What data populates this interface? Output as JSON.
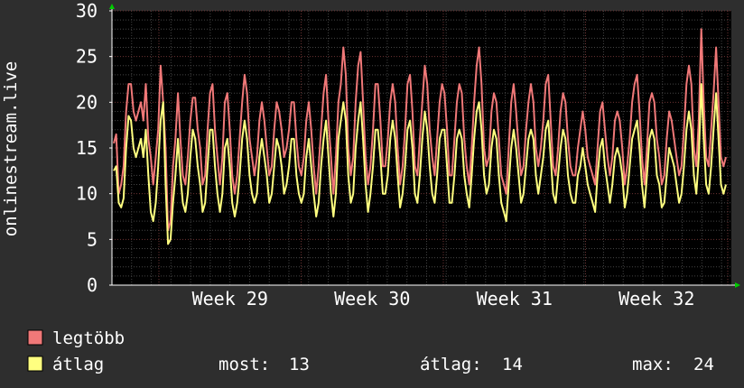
{
  "chart_data": {
    "type": "line",
    "ylabel": "onlinestream.live",
    "ylim": [
      0,
      30
    ],
    "yticks": [
      0,
      5,
      10,
      15,
      20,
      25,
      30
    ],
    "x_tick_labels": [
      "Week 29",
      "Week 30",
      "Week 31",
      "Week 32"
    ],
    "grid": true,
    "legend_placement": "bottom-left",
    "colors": {
      "background": "#2e2e2e",
      "plot_background": "#000000",
      "grid_major": "#6b3333",
      "grid_minor": "#444444",
      "axis": "#ffffff",
      "arrow": "#00cc00"
    },
    "series": [
      {
        "name": "legtöbb",
        "color": "#f07878",
        "values": [
          15.5,
          16.5,
          10,
          11,
          13,
          19,
          22,
          22,
          19,
          18,
          19,
          20,
          18,
          22,
          16,
          14,
          11,
          14,
          17,
          24,
          20,
          15,
          6,
          7,
          13,
          16,
          21,
          16,
          12,
          11,
          14,
          18,
          20.5,
          20.5,
          17,
          15,
          11,
          12,
          17,
          21,
          22,
          17,
          14,
          11,
          14,
          20,
          21,
          17,
          12,
          10,
          12,
          16,
          20,
          23,
          21,
          16,
          14,
          12,
          14,
          18,
          20,
          18,
          15,
          12,
          13,
          17,
          20,
          19,
          17,
          14,
          15,
          17,
          20,
          20,
          16,
          13,
          12,
          14,
          18,
          20,
          17,
          13,
          10,
          13,
          17,
          21,
          23,
          18,
          14,
          10,
          14,
          20,
          22,
          26,
          23,
          15,
          12,
          14,
          20,
          24,
          25.5,
          20,
          14,
          11,
          13,
          17,
          22,
          22,
          18,
          13,
          13,
          16,
          20,
          22,
          20,
          15,
          11,
          13,
          17,
          22,
          23,
          19,
          13,
          12,
          16,
          20,
          24,
          22,
          17,
          14,
          12,
          16,
          20,
          22,
          21,
          17,
          12,
          12,
          16,
          20,
          22,
          21,
          16,
          13,
          11,
          15,
          20,
          24,
          26,
          22,
          15,
          13,
          14,
          19,
          21,
          20,
          16,
          12,
          11,
          10,
          15,
          20,
          22,
          19,
          15,
          12,
          13,
          17,
          20,
          22,
          20,
          15,
          13,
          15,
          18,
          22,
          23,
          18,
          13,
          12,
          15,
          19,
          21,
          20,
          16,
          13,
          12,
          12,
          15,
          17,
          19,
          17,
          14,
          13,
          12,
          11,
          15,
          19,
          20,
          17,
          14,
          12,
          14,
          18,
          19,
          18,
          15,
          11,
          13,
          16,
          20,
          22,
          23,
          19,
          14,
          11,
          15,
          20,
          21,
          20,
          16,
          14,
          11,
          12,
          16,
          19,
          18,
          16,
          14,
          12,
          13,
          17,
          22,
          24,
          22,
          15,
          13,
          18,
          28,
          20,
          14,
          13,
          17,
          21,
          26,
          20,
          14,
          13,
          14
        ]
      },
      {
        "name": "átlag",
        "color": "#ffff80",
        "values": [
          12.5,
          13,
          9,
          8.5,
          9.5,
          15,
          18.5,
          18,
          15,
          14,
          15,
          16,
          14,
          17,
          12,
          8,
          7,
          9,
          13,
          18,
          20,
          11,
          4.5,
          5,
          9,
          12,
          16,
          12,
          9,
          8,
          10,
          14,
          17,
          16,
          13,
          11,
          8,
          9,
          13,
          17,
          17,
          13,
          10,
          8,
          10,
          15,
          16,
          13,
          9,
          7.5,
          9,
          12,
          16,
          18,
          16,
          12,
          10,
          9,
          10,
          14,
          16,
          14,
          12,
          9,
          10,
          13,
          16,
          15,
          13,
          10,
          11,
          13,
          16,
          16,
          12,
          10,
          9,
          10,
          14,
          16,
          13,
          10,
          7.5,
          9,
          13,
          16,
          18,
          14,
          10,
          7.5,
          10,
          16,
          18,
          20,
          18,
          12,
          9,
          10,
          15,
          18,
          20,
          16,
          11,
          8,
          10,
          13,
          17,
          17,
          14,
          10,
          10,
          12,
          16,
          18,
          16,
          12,
          8.5,
          10,
          13,
          17,
          18,
          15,
          10,
          9,
          12,
          16,
          19,
          17,
          13,
          10,
          9,
          12,
          16,
          17,
          17,
          13,
          9,
          9,
          12,
          16,
          17,
          16,
          12,
          10,
          8.5,
          12,
          16,
          19,
          20,
          17,
          12,
          10,
          11,
          15,
          17,
          16,
          12,
          9,
          8,
          7,
          11,
          15,
          17,
          15,
          12,
          9,
          10,
          13,
          16,
          17,
          16,
          12,
          10,
          12,
          14,
          17,
          18,
          14,
          10,
          9,
          12,
          15,
          17,
          16,
          12,
          10,
          9,
          9,
          12,
          13,
          15,
          13,
          11,
          10,
          9,
          8,
          12,
          15,
          16,
          13,
          11,
          9,
          11,
          14,
          15,
          14,
          12,
          8.5,
          10,
          13,
          16,
          17,
          18,
          15,
          11,
          8.5,
          12,
          16,
          17,
          16,
          12,
          11,
          8.5,
          9,
          12,
          15,
          14,
          13,
          11,
          9,
          10,
          13,
          17,
          19,
          17,
          12,
          10,
          14,
          22,
          16,
          11,
          10,
          13,
          17,
          21,
          16,
          11,
          10,
          11
        ]
      }
    ]
  },
  "legend": {
    "items": [
      {
        "label": "legtöbb",
        "color": "#f07878"
      },
      {
        "label": "átlag",
        "color": "#ffff80"
      }
    ],
    "stats": {
      "most_label": "most:",
      "most_value": "13",
      "avg_label": "átlag:",
      "avg_value": "14",
      "max_label": "max:",
      "max_value": "24"
    }
  }
}
